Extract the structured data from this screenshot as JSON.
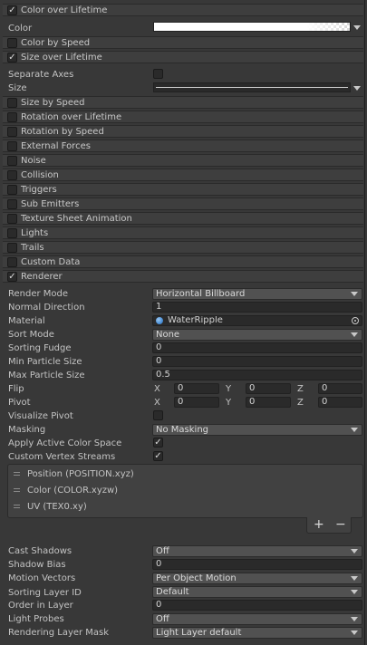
{
  "modules": [
    {
      "label": "Color over Lifetime",
      "enabled": true
    },
    {
      "label": "Color by Speed",
      "enabled": false
    },
    {
      "label": "Size over Lifetime",
      "enabled": true
    },
    {
      "label": "Size by Speed",
      "enabled": false
    },
    {
      "label": "Rotation over Lifetime",
      "enabled": false
    },
    {
      "label": "Rotation by Speed",
      "enabled": false
    },
    {
      "label": "External Forces",
      "enabled": false
    },
    {
      "label": "Noise",
      "enabled": false
    },
    {
      "label": "Collision",
      "enabled": false
    },
    {
      "label": "Triggers",
      "enabled": false
    },
    {
      "label": "Sub Emitters",
      "enabled": false
    },
    {
      "label": "Texture Sheet Animation",
      "enabled": false
    },
    {
      "label": "Lights",
      "enabled": false
    },
    {
      "label": "Trails",
      "enabled": false
    },
    {
      "label": "Custom Data",
      "enabled": false
    },
    {
      "label": "Renderer",
      "enabled": true
    }
  ],
  "color_over_lifetime": {
    "color_label": "Color"
  },
  "size_over_lifetime": {
    "separate_axes_label": "Separate Axes",
    "size_label": "Size"
  },
  "renderer": {
    "render_mode": {
      "label": "Render Mode",
      "value": "Horizontal Billboard"
    },
    "normal_direction": {
      "label": "Normal Direction",
      "value": "1"
    },
    "material": {
      "label": "Material",
      "value": "WaterRipple"
    },
    "sort_mode": {
      "label": "Sort Mode",
      "value": "None"
    },
    "sorting_fudge": {
      "label": "Sorting Fudge",
      "value": "0"
    },
    "min_particle_size": {
      "label": "Min Particle Size",
      "value": "0"
    },
    "max_particle_size": {
      "label": "Max Particle Size",
      "value": "0.5"
    },
    "flip": {
      "label": "Flip",
      "x_label": "X",
      "x": "0",
      "y_label": "Y",
      "y": "0",
      "z_label": "Z",
      "z": "0"
    },
    "pivot": {
      "label": "Pivot",
      "x_label": "X",
      "x": "0",
      "y_label": "Y",
      "y": "0",
      "z_label": "Z",
      "z": "0"
    },
    "visualize_pivot": {
      "label": "Visualize Pivot",
      "checked": false
    },
    "masking": {
      "label": "Masking",
      "value": "No Masking"
    },
    "apply_active_color_space": {
      "label": "Apply Active Color Space",
      "checked": true
    },
    "custom_vertex_streams": {
      "label": "Custom Vertex Streams",
      "checked": true
    },
    "streams": [
      "Position (POSITION.xyz)",
      "Color (COLOR.xyzw)",
      "UV (TEX0.xy)"
    ],
    "add_symbol": "+",
    "remove_symbol": "−",
    "cast_shadows": {
      "label": "Cast Shadows",
      "value": "Off"
    },
    "shadow_bias": {
      "label": "Shadow Bias",
      "value": "0"
    },
    "motion_vectors": {
      "label": "Motion Vectors",
      "value": "Per Object Motion"
    },
    "sorting_layer_id": {
      "label": "Sorting Layer ID",
      "value": "Default"
    },
    "order_in_layer": {
      "label": "Order in Layer",
      "value": "0"
    },
    "light_probes": {
      "label": "Light Probes",
      "value": "Off"
    },
    "rendering_layer_mask": {
      "label": "Rendering Layer Mask",
      "value": "Light Layer default"
    }
  },
  "icons": {
    "checkmark": "checkmark-icon",
    "dropdown": "dropdown-arrow-icon",
    "object_picker": "object-picker-icon",
    "material": "material-sphere-icon",
    "drag_handle": "drag-handle-icon"
  },
  "colors": {
    "background": "#383838",
    "module_header": "#3e3e3e",
    "field": "#2a2a2a",
    "dropdown": "#515151",
    "material_icon": "#4a8fd8"
  }
}
